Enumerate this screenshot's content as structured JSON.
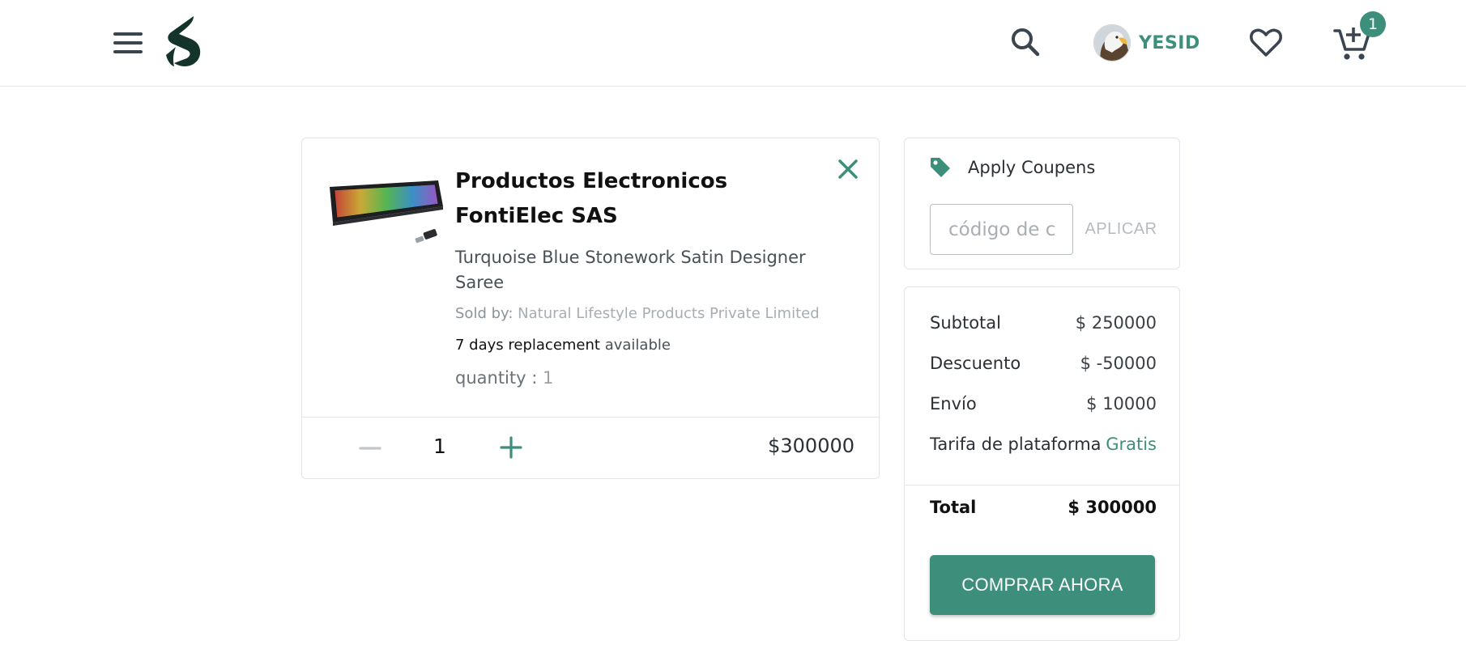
{
  "colors": {
    "accent": "#3d8f7c",
    "text_dark": "#111111",
    "muted": "#8c939a",
    "border": "#e1e4e8"
  },
  "header": {
    "menu_icon": "hamburger-menu-icon",
    "logo_icon": "brand-s-logo",
    "search_icon": "search-icon",
    "user": {
      "name": "YESID",
      "avatar_icon": "eagle-avatar"
    },
    "wishlist_icon": "heart-icon",
    "cart_icon": "cart-add-icon",
    "cart_count": "1"
  },
  "cart_item": {
    "image_icon": "rgb-keyboard-product-image",
    "remove_icon": "close-icon",
    "title": "Productos Electronicos FontiElec SAS",
    "subtitle": "Turquoise Blue Stonework Satin Designer Saree",
    "sold_by_label": "Sold by:",
    "seller": "Natural Lifestyle Products Private Limited",
    "replacement_label": "7 days replacement",
    "replacement_suffix": "available",
    "quantity_label": "quantity :",
    "quantity_value": "1",
    "stepper_value": "1",
    "minus_icon": "minus-icon",
    "plus_icon": "plus-icon",
    "price": "$300000"
  },
  "coupon": {
    "icon": "tag-icon",
    "title": "Apply Coupens",
    "placeholder": "código de cupón",
    "apply_label": "APLICAR"
  },
  "summary": {
    "rows": [
      {
        "label": "Subtotal",
        "value": "$ 250000"
      },
      {
        "label": "Descuento",
        "value": "$ -50000"
      },
      {
        "label": "Envío",
        "value": "$ 10000"
      },
      {
        "label": "Tarifa de plataforma",
        "value": "Gratis"
      }
    ],
    "total_label": "Total",
    "total_value": "$ 300000",
    "buy_label": "COMPRAR AHORA"
  }
}
